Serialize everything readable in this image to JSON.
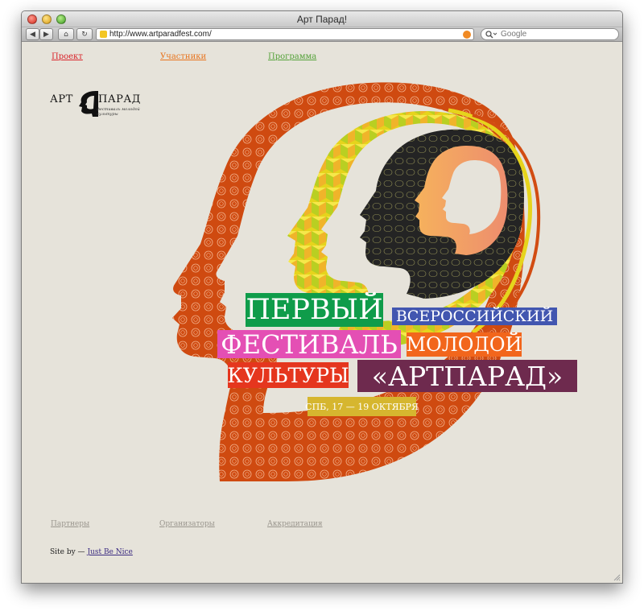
{
  "window": {
    "title": "Арт Парад!"
  },
  "toolbar": {
    "url": "http://www.artparadfest.com/",
    "search_placeholder": "Google"
  },
  "nav": [
    {
      "label": "Проект",
      "color": "#d9242b"
    },
    {
      "label": "Участники",
      "color": "#e8731c"
    },
    {
      "label": "Программа",
      "color": "#55a23a"
    }
  ],
  "logo": {
    "left": "АРТ",
    "right": "ПАРАД",
    "subtitle": "фестиваль молодой культуры"
  },
  "poster": {
    "line1": "ПЕРВЫЙ",
    "line1b": "ВСЕРОССИЙСКИЙ",
    "line2": "ФЕСТИВАЛЬ",
    "line2b": "МОЛОДОЙ",
    "line3": "КУЛЬТУРЫ",
    "line3b": "«АРТПАРАД»",
    "dates": "СПБ, 17 — 19 ОКТЯБРЯ"
  },
  "footer_nav": [
    "Партнеры",
    "Организаторы",
    "Аккредитация"
  ],
  "credit": {
    "prefix": "Site by —",
    "link": "Just Be Nice"
  },
  "colors": {
    "head_outer": "#d24c12",
    "head_yellow": "#e3d21f",
    "head_dark": "#262626",
    "head_peach": "#f1a866",
    "block_green": "#0f9c4a",
    "block_blue": "#4256b0",
    "block_pink": "#e44fb4",
    "block_orange": "#f2661c",
    "block_red": "#e5361e",
    "block_purple": "#6e2a4e",
    "block_gold": "#d6b62f"
  }
}
